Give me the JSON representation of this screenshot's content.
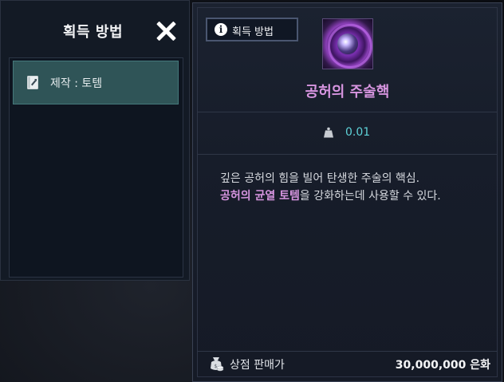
{
  "acquisition_panel": {
    "title": "획득 방법",
    "close_icon": "close-icon",
    "methods": [
      {
        "label": "제작 : 토템",
        "icon": "crafting-book-icon"
      }
    ]
  },
  "item_card": {
    "acquisition_button_label": "획득 방법",
    "info_icon_glyph": "i",
    "item_name": "공허의 주술핵",
    "item_name_color": "#d795e0",
    "weight": "0.01",
    "weight_icon": "weight-icon",
    "description": {
      "line1": "깊은 공허의 힘을 빌어 탄생한 주술의 핵심.",
      "line2_highlight": "공허의 균열 토템",
      "line2_rest": "을 강화하는데 사용할 수 있다."
    },
    "price": {
      "label": "상점 판매가",
      "value": "30,000,000 은화",
      "icon": "silver-coin-icon"
    }
  }
}
